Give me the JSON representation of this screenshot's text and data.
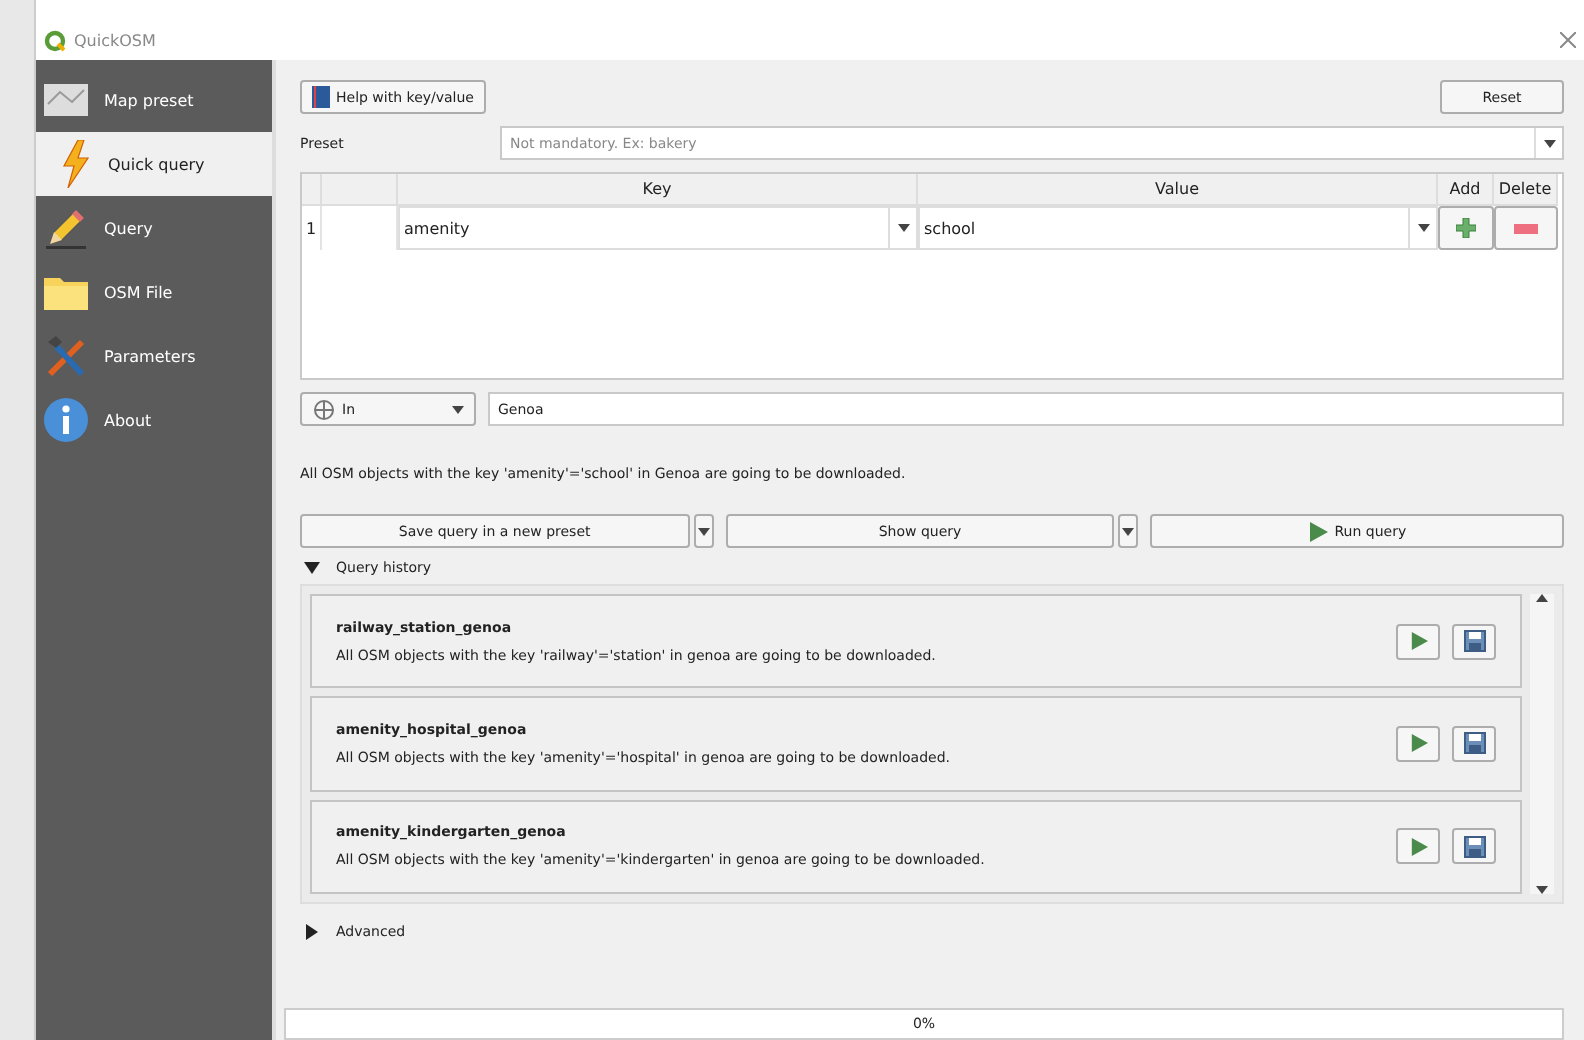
{
  "window": {
    "title": "QuickOSM"
  },
  "sidebar": {
    "items": [
      {
        "label": "Map preset",
        "selected": false
      },
      {
        "label": "Quick query",
        "selected": true
      },
      {
        "label": "Query",
        "selected": false
      },
      {
        "label": "OSM File",
        "selected": false
      },
      {
        "label": "Parameters",
        "selected": false
      },
      {
        "label": "About",
        "selected": false
      }
    ]
  },
  "toolbar": {
    "help_button": "Help with key/value",
    "reset_button": "Reset"
  },
  "preset": {
    "label": "Preset",
    "placeholder": "Not mandatory. Ex: bakery"
  },
  "table": {
    "columns": [
      "Key",
      "Value",
      "Add",
      "Delete"
    ],
    "rows": [
      {
        "number": "1",
        "key": "amenity",
        "value": "school"
      }
    ]
  },
  "location": {
    "mode": "In",
    "place": "Genoa"
  },
  "description": "All OSM objects with the key 'amenity'='school' in Genoa are going to be downloaded.",
  "actions": [
    {
      "label": "Save query in a new preset",
      "kind": "split"
    },
    {
      "label": "Show query",
      "kind": "split"
    },
    {
      "label": "Run query",
      "kind": "run"
    }
  ],
  "query_history": {
    "label": "Query history",
    "expanded": true,
    "items": [
      {
        "name": "railway_station_genoa",
        "description": "All OSM objects with the key 'railway'='station' in genoa are going to be downloaded."
      },
      {
        "name": "amenity_hospital_genoa",
        "description": "All OSM objects with the key 'amenity'='hospital' in genoa are going to be downloaded."
      },
      {
        "name": "amenity_kindergarten_genoa",
        "description": "All OSM objects with the key 'amenity'='kindergarten' in genoa are going to be downloaded."
      }
    ]
  },
  "advanced": {
    "label": "Advanced",
    "expanded": false
  },
  "progress": {
    "label": "0%",
    "level": 0
  }
}
